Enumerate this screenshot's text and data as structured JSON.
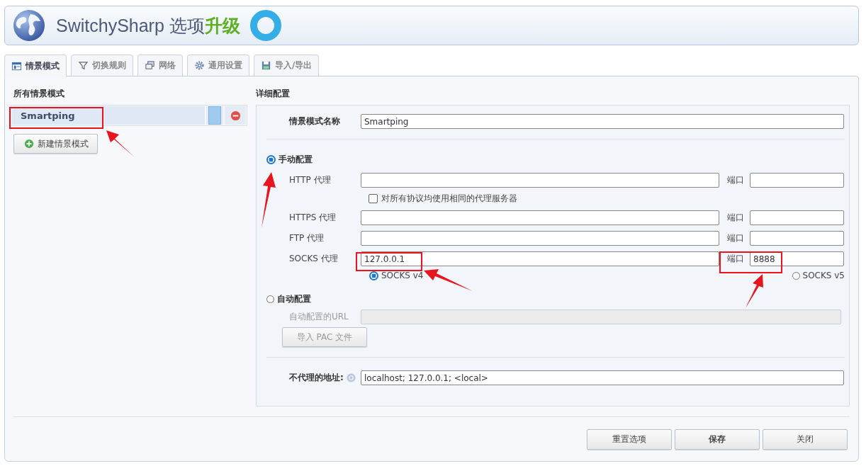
{
  "header": {
    "title": "SwitchySharp 选项",
    "upgrade": "升级"
  },
  "tabs": [
    {
      "label": "情景模式",
      "selected": true,
      "kind": "profiles"
    },
    {
      "label": "切换规则",
      "selected": false,
      "kind": "rules"
    },
    {
      "label": "网络",
      "selected": false,
      "kind": "network"
    },
    {
      "label": "通用设置",
      "selected": false,
      "kind": "general"
    },
    {
      "label": "导入/导出",
      "selected": false,
      "kind": "io"
    }
  ],
  "profiles": {
    "heading": "所有情景模式",
    "items": [
      {
        "name": "Smartping",
        "selected": true
      }
    ],
    "new_button": "新建情景模式"
  },
  "details": {
    "heading": "详细配置",
    "name_label": "情景模式名称",
    "name_value": "Smartping",
    "manual": {
      "label": "手动配置",
      "selected": true
    },
    "proxies": [
      {
        "label": "HTTP 代理",
        "port_label": "端口"
      },
      {
        "label": "HTTPS 代理",
        "port_label": "端口"
      },
      {
        "label": "FTP 代理",
        "port_label": "端口"
      },
      {
        "label": "SOCKS 代理",
        "host": "127.0.0.1",
        "port_label": "端口",
        "port": "8888"
      }
    ],
    "same_proxy": {
      "label": "对所有协议均使用相同的代理服务器",
      "checked": false
    },
    "socks_versions": [
      {
        "label": "SOCKS v4",
        "selected": true
      },
      {
        "label": "SOCKS v5",
        "selected": false
      }
    ],
    "auto": {
      "label": "自动配置",
      "selected": false,
      "disabled": true,
      "url_label": "自动配置的URL",
      "import_button": "导入 PAC 文件"
    },
    "bypass": {
      "label": "不代理的地址:",
      "value": "localhost; 127.0.0.1; <local>"
    }
  },
  "buttons": [
    {
      "label": "重置选项",
      "primary": false
    },
    {
      "label": "保存",
      "primary": true
    },
    {
      "label": "关闭",
      "primary": false
    }
  ]
}
